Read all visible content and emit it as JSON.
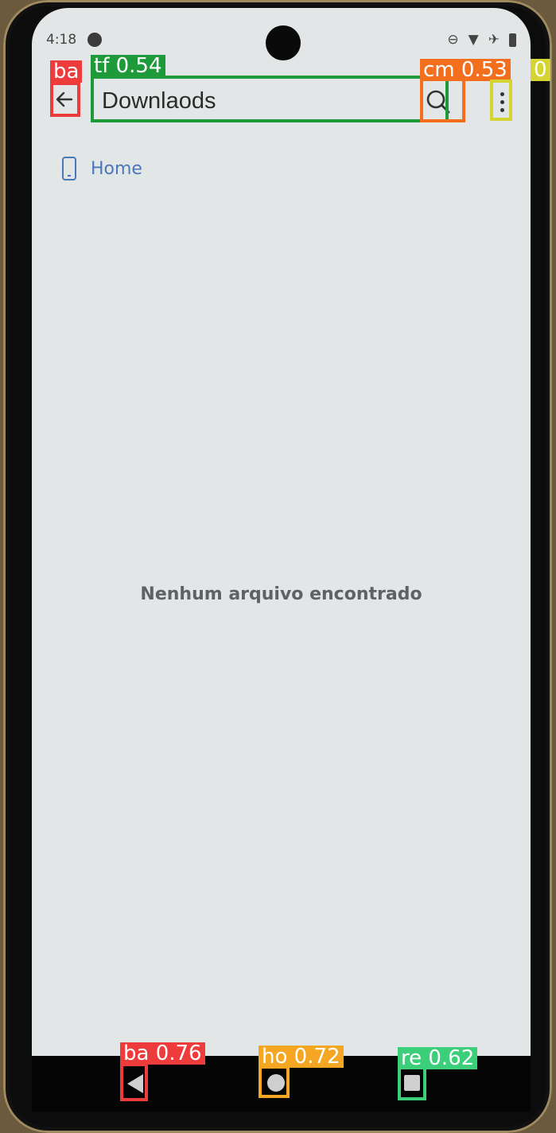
{
  "status_bar": {
    "time": "4:18",
    "icons": [
      "dnd-icon",
      "wifi-icon",
      "airplane-icon",
      "battery-icon"
    ]
  },
  "toolbar": {
    "search_value": "Downlaods",
    "back_icon": "arrow-left-icon",
    "search_icon": "search-icon",
    "more_icon": "more-vert-icon"
  },
  "breadcrumb": {
    "icon": "phone-icon",
    "label": "Home"
  },
  "content": {
    "empty_message": "Nenhum arquivo encontrado"
  },
  "system_nav": {
    "buttons": [
      "back",
      "home",
      "recents"
    ]
  },
  "detections": [
    {
      "label": "ba",
      "color": "#ee3b3b"
    },
    {
      "label": "tf 0.54",
      "color": "#1f9a3a"
    },
    {
      "label": "cm 0.53",
      "color": "#f36f1e"
    },
    {
      "label": "0",
      "color": "#d4d432"
    },
    {
      "label": "ba 0.76",
      "color": "#ee3b3b"
    },
    {
      "label": "ho 0.72",
      "color": "#f5a623"
    },
    {
      "label": "re 0.62",
      "color": "#3ccf7a"
    }
  ]
}
